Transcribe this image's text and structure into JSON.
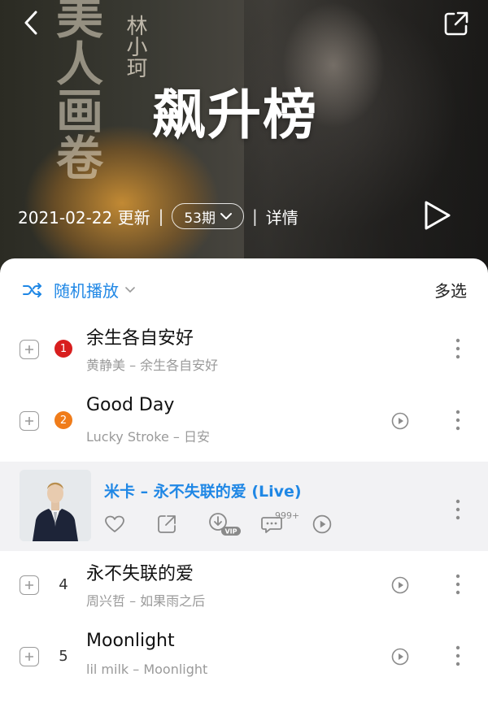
{
  "header": {
    "title": "飙升榜",
    "update_date": "2021-02-22 更新",
    "issue": "53期",
    "detail_label": "详情",
    "poster_calligraphy": "美人画卷",
    "poster_artist": "林小珂"
  },
  "toolbar": {
    "shuffle_label": "随机播放",
    "multi_select_label": "多选"
  },
  "songs": [
    {
      "rank": "1",
      "title": "余生各自安好",
      "subtitle": "黄静美 – 余生各自安好",
      "has_mv": false,
      "rank_color": "#d81e1e"
    },
    {
      "rank": "2",
      "title": "Good Day",
      "subtitle": "Lucky Stroke – 日安",
      "has_mv": true,
      "rank_color": "#f07c1a"
    },
    {
      "rank": "4",
      "title": "永不失联的爱",
      "subtitle": "周兴哲 – 如果雨之后",
      "has_mv": true
    },
    {
      "rank": "5",
      "title": "Moonlight",
      "subtitle": "lil milk – Moonlight",
      "has_mv": true
    }
  ],
  "active_song": {
    "title": "米卡 – 永不失联的爱 (Live)",
    "comment_count": "999+",
    "vip_tag": "VIP"
  },
  "colors": {
    "accent": "#1f87e5",
    "rank1": "#d81e1e",
    "rank2": "#f07c1a"
  }
}
